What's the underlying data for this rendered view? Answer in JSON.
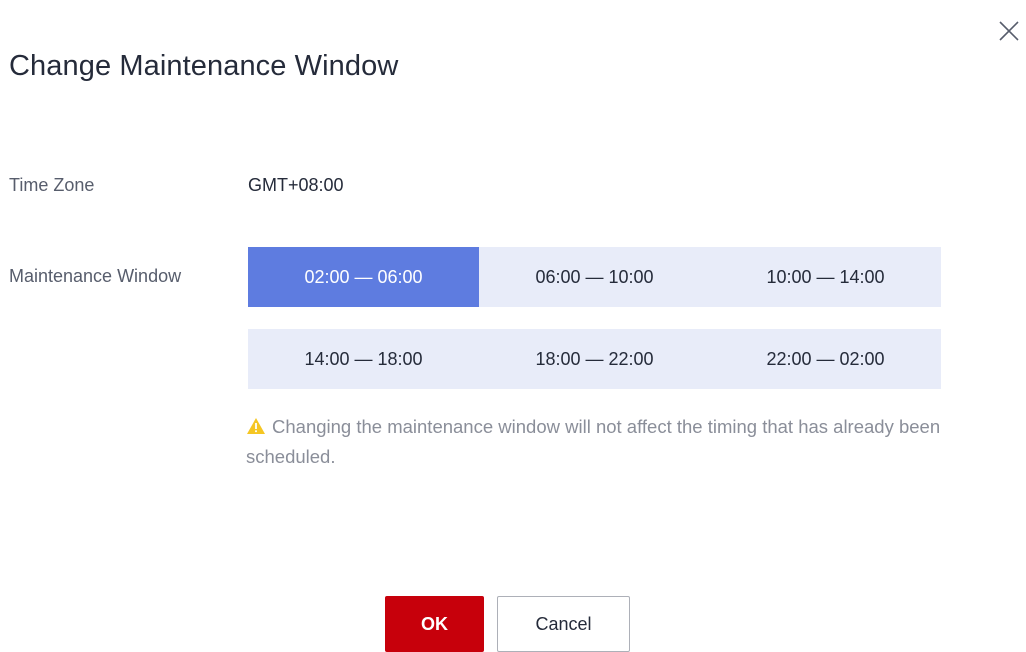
{
  "dialog": {
    "title": "Change Maintenance Window",
    "close_icon": "close-icon"
  },
  "time_zone": {
    "label": "Time Zone",
    "value": "GMT+08:00"
  },
  "maintenance_window": {
    "label": "Maintenance Window",
    "selected": "02:00 — 06:00",
    "rows": [
      [
        {
          "label": "02:00 — 06:00",
          "selected": true
        },
        {
          "label": "06:00 — 10:00",
          "selected": false
        },
        {
          "label": "10:00 — 14:00",
          "selected": false
        }
      ],
      [
        {
          "label": "14:00 — 18:00",
          "selected": false
        },
        {
          "label": "18:00 — 22:00",
          "selected": false
        },
        {
          "label": "22:00 — 02:00",
          "selected": false
        }
      ]
    ]
  },
  "notice": {
    "icon": "warning-icon",
    "text": "Changing the maintenance window will not affect the timing that has already been scheduled."
  },
  "footer": {
    "ok_label": "OK",
    "cancel_label": "Cancel"
  },
  "colors": {
    "selected_slot": "#5e7ce0",
    "slot_background": "#e8ecf9",
    "ok_button": "#c7000b",
    "warning": "#f5c623"
  }
}
